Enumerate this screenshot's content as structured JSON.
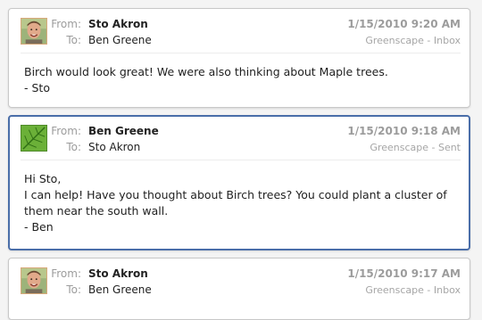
{
  "labels": {
    "from": "From:",
    "to": "To:"
  },
  "messages": [
    {
      "from": "Sto Akron",
      "to": "Ben Greene",
      "date": "1/15/2010 9:20 AM",
      "folder": "Greenscape - Inbox",
      "body": "Birch would look great!  We were also thinking about Maple trees.\n- Sto",
      "avatar_icon": "person-photo-icon"
    },
    {
      "from": "Ben Greene",
      "to": "Sto Akron",
      "date": "1/15/2010 9:18 AM",
      "folder": "Greenscape - Sent",
      "body": "Hi Sto,\nI can help!  Have you thought about Birch trees?  You could plant a cluster of\nthem near the south wall.\n- Ben",
      "avatar_icon": "leaf-icon"
    },
    {
      "from": "Sto Akron",
      "to": "Ben Greene",
      "date": "1/15/2010 9:17 AM",
      "folder": "Greenscape - Inbox",
      "body": "",
      "avatar_icon": "person-photo-icon"
    }
  ],
  "colors": {
    "selected_border": "#4a6ea9",
    "leaf_green": "#5aa02c"
  }
}
